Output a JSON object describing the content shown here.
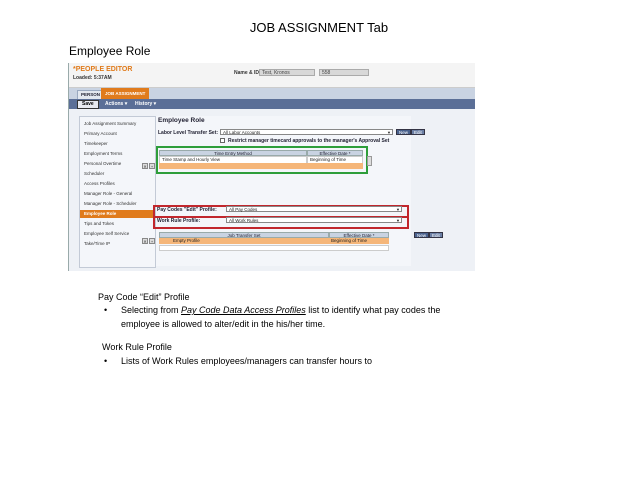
{
  "slide": {
    "title": "JOB ASSIGNMENT Tab",
    "subtitle": "Employee Role"
  },
  "app": {
    "name": "*PEOPLE EDITOR",
    "loaded": "Loaded: 5:37AM",
    "name_id_label": "Name & ID:",
    "name_value": "Test, Kronos",
    "id_value": "558"
  },
  "tabs": [
    {
      "label": "PERSON"
    },
    {
      "label": "JOB ASSIGNMENT"
    }
  ],
  "toolbar": {
    "save_label": "Save",
    "actions_label": "Actions ▾",
    "history_label": "History ▾"
  },
  "nav": {
    "items": [
      "Job Assignment Summary",
      "Primary Account",
      "Timekeeper",
      "Employment Terms",
      "Personal Overtime",
      "Scheduler",
      "Access Profiles",
      "Manager Role - General",
      "Manager Role - Scheduler",
      "Employee Role",
      "Tips and Tokes",
      "Employee Self Service",
      "Take/Time IP"
    ],
    "selected_index": 9
  },
  "main": {
    "title": "Employee Role",
    "llts_label": "Labor Level Transfer Set:",
    "llts_value": "All Labor Accounts",
    "new_label": "New",
    "edit_label": "Edit",
    "restrict_label": "Restrict manager timecard approvals to the manager's Approval Set",
    "tem_table": {
      "headers": [
        "Time Entry Method",
        "Effective Date *"
      ],
      "row": [
        "Time Stamp and Hourly View",
        "Beginning of Time"
      ]
    },
    "pay_codes_label": "Pay Codes \"Edit\" Profile:",
    "pay_codes_value": "All Pay Codes",
    "work_rule_label": "Work Rule Profile:",
    "work_rule_value": "All Work Rules",
    "jts_table": {
      "headers": [
        "Job Transfer Set",
        "Effective Date *"
      ],
      "row": [
        "Empty Profile",
        "Beginning of Time"
      ]
    }
  },
  "notes": {
    "pay_code_heading": "Pay Code “Edit” Profile",
    "pay_code_bullet_pre": "Selecting from ",
    "pay_code_bullet_link": "Pay Code Data Access Profiles",
    "pay_code_bullet_post": " list to identify what pay codes the",
    "pay_code_bullet_line2": "employee is allowed to alter/edit in the his/her time.",
    "work_rule_heading": "Work Rule Profile",
    "work_rule_bullet": "Lists of Work Rules employees/managers can transfer hours to",
    "bullet_char": "•"
  },
  "colors": {
    "accent_orange": "#e07b1c",
    "highlight_green": "#2e9e3a",
    "highlight_red": "#c1272d",
    "toolbar_blue": "#5b6f97"
  }
}
